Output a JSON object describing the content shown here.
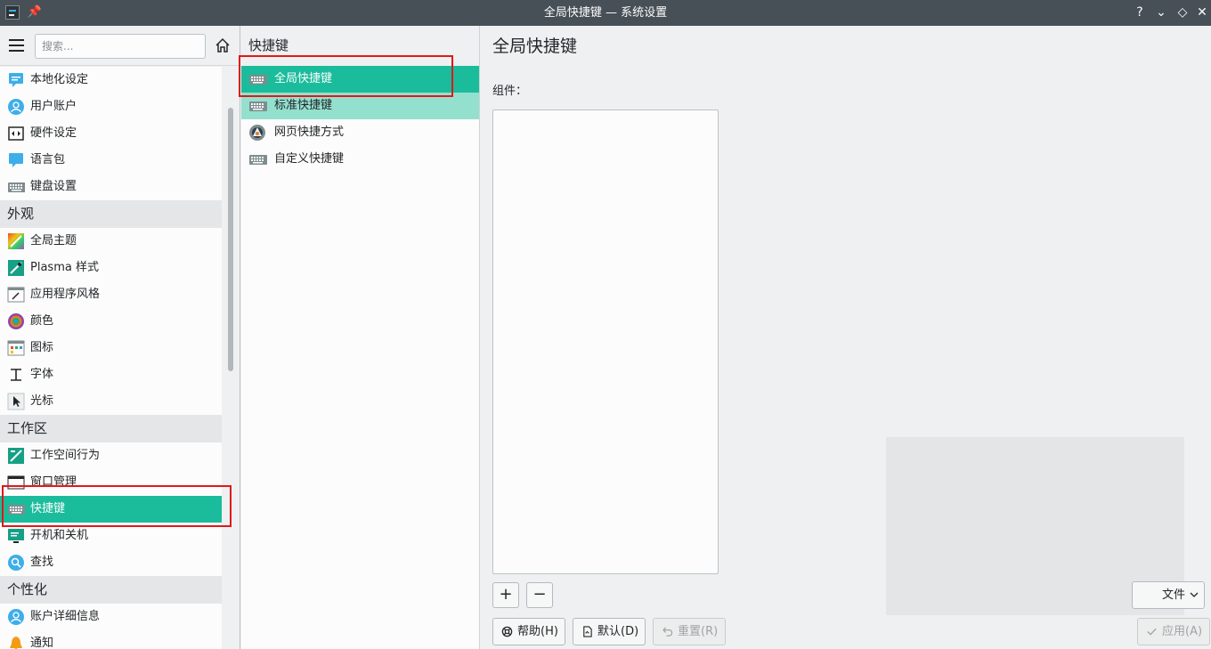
{
  "window": {
    "title": "全局快捷键 — 系统设置",
    "help_glyph": "?",
    "minimize_glyph": "⌄",
    "maximize_glyph": "◇",
    "close_glyph": "✕"
  },
  "sidebar": {
    "search_placeholder": "搜索...",
    "items": [
      {
        "label": "本地化设定",
        "icon": "locale-icon"
      },
      {
        "label": "用户账户",
        "icon": "user-icon"
      },
      {
        "label": "硬件设定",
        "icon": "hardware-icon"
      },
      {
        "label": "语言包",
        "icon": "language-icon"
      },
      {
        "label": "键盘设置",
        "icon": "keyboard-icon"
      },
      {
        "category": "外观"
      },
      {
        "label": "全局主题",
        "icon": "global-theme-icon"
      },
      {
        "label": "Plasma 样式",
        "icon": "plasma-style-icon"
      },
      {
        "label": "应用程序风格",
        "icon": "app-style-icon"
      },
      {
        "label": "颜色",
        "icon": "color-icon"
      },
      {
        "label": "图标",
        "icon": "icons-icon"
      },
      {
        "label": "字体",
        "icon": "font-icon"
      },
      {
        "label": "光标",
        "icon": "cursor-icon"
      },
      {
        "category": "工作区"
      },
      {
        "label": "工作空间行为",
        "icon": "workspace-icon"
      },
      {
        "label": "窗口管理",
        "icon": "window-icon"
      },
      {
        "label": "快捷键",
        "icon": "keyboard-icon",
        "selected": true
      },
      {
        "label": "开机和关机",
        "icon": "startup-icon"
      },
      {
        "label": "查找",
        "icon": "search-icon"
      },
      {
        "category": "个性化"
      },
      {
        "label": "账户详细信息",
        "icon": "user-icon"
      },
      {
        "label": "通知",
        "icon": "bell-icon"
      }
    ]
  },
  "middle": {
    "header": "快捷键",
    "items": [
      {
        "label": "全局快捷键",
        "icon": "keyboard-icon",
        "state": "selected"
      },
      {
        "label": "标准快捷键",
        "icon": "keyboard-icon",
        "state": "hover"
      },
      {
        "label": "网页快捷方式",
        "icon": "web-shortcut-icon",
        "state": ""
      },
      {
        "label": "自定义快捷键",
        "icon": "keyboard-icon",
        "state": ""
      }
    ]
  },
  "right": {
    "title": "全局快捷键",
    "component_label": "组件：",
    "add_label": "+",
    "remove_label": "−",
    "file_dropdown": "文件",
    "help_button": "帮助(H)",
    "default_button": "默认(D)",
    "reset_button": "重置(R)",
    "apply_button": "应用(A)"
  },
  "colors": {
    "accent": "#1abc9c",
    "hover": "#93e0ce",
    "titlebar": "#475057",
    "highlight_box": "#e0191a"
  }
}
